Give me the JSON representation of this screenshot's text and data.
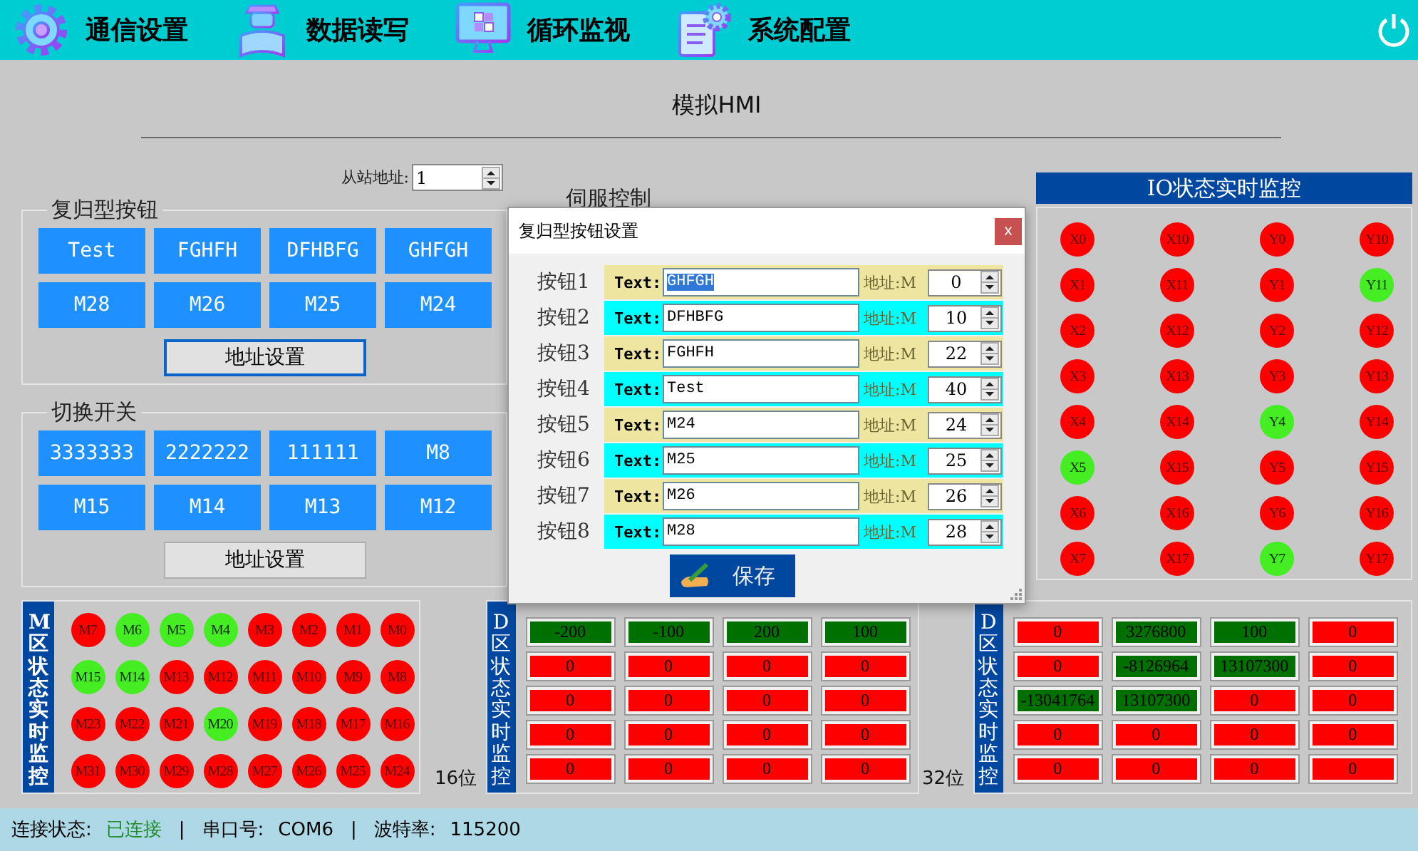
{
  "nav": {
    "items": [
      {
        "label": "通信设置"
      },
      {
        "label": "数据读写"
      },
      {
        "label": "循环监视"
      },
      {
        "label": "系统配置"
      }
    ]
  },
  "title": "模拟HMI",
  "slave_address": {
    "label": "从站地址:",
    "value": "1"
  },
  "reset_buttons": {
    "title": "复归型按钮",
    "buttons": [
      "Test",
      "FGHFH",
      "DFHBFG",
      "GHFGH",
      "M28",
      "M26",
      "M25",
      "M24"
    ],
    "address_button": {
      "label": "地址设置",
      "focused": true
    }
  },
  "toggle_switches": {
    "title": "切换开关",
    "buttons": [
      "3333333",
      "2222222",
      "111111",
      "M8",
      "M15",
      "M14",
      "M13",
      "M12"
    ],
    "address_button": {
      "label": "地址设置",
      "focused": false
    }
  },
  "servo_control": {
    "title": "伺服控制"
  },
  "io_monitor": {
    "title": "IO状态实时监控",
    "lamps": [
      {
        "label": "X0",
        "on": false
      },
      {
        "label": "X10",
        "on": false
      },
      {
        "label": "Y0",
        "on": false
      },
      {
        "label": "Y10",
        "on": false
      },
      {
        "label": "X1",
        "on": false
      },
      {
        "label": "X11",
        "on": false
      },
      {
        "label": "Y1",
        "on": false
      },
      {
        "label": "Y11",
        "on": true
      },
      {
        "label": "X2",
        "on": false
      },
      {
        "label": "X12",
        "on": false
      },
      {
        "label": "Y2",
        "on": false
      },
      {
        "label": "Y12",
        "on": false
      },
      {
        "label": "X3",
        "on": false
      },
      {
        "label": "X13",
        "on": false
      },
      {
        "label": "Y3",
        "on": false
      },
      {
        "label": "Y13",
        "on": false
      },
      {
        "label": "X4",
        "on": false
      },
      {
        "label": "X14",
        "on": false
      },
      {
        "label": "Y4",
        "on": true
      },
      {
        "label": "Y14",
        "on": false
      },
      {
        "label": "X5",
        "on": true
      },
      {
        "label": "X15",
        "on": false
      },
      {
        "label": "Y5",
        "on": false
      },
      {
        "label": "Y15",
        "on": false
      },
      {
        "label": "X6",
        "on": false
      },
      {
        "label": "X16",
        "on": false
      },
      {
        "label": "Y6",
        "on": false
      },
      {
        "label": "Y16",
        "on": false
      },
      {
        "label": "X7",
        "on": false
      },
      {
        "label": "X17",
        "on": false
      },
      {
        "label": "Y7",
        "on": true
      },
      {
        "label": "Y17",
        "on": false
      }
    ]
  },
  "m_monitor": {
    "title": "M区状态实时监控",
    "lamps": [
      {
        "label": "M7",
        "on": false
      },
      {
        "label": "M6",
        "on": true
      },
      {
        "label": "M5",
        "on": true
      },
      {
        "label": "M4",
        "on": true
      },
      {
        "label": "M3",
        "on": false
      },
      {
        "label": "M2",
        "on": false
      },
      {
        "label": "M1",
        "on": false
      },
      {
        "label": "M0",
        "on": false
      },
      {
        "label": "M15",
        "on": true
      },
      {
        "label": "M14",
        "on": true
      },
      {
        "label": "M13",
        "on": false
      },
      {
        "label": "M12",
        "on": false
      },
      {
        "label": "M11",
        "on": false
      },
      {
        "label": "M10",
        "on": false
      },
      {
        "label": "M9",
        "on": false
      },
      {
        "label": "M8",
        "on": false
      },
      {
        "label": "M23",
        "on": false
      },
      {
        "label": "M22",
        "on": false
      },
      {
        "label": "M21",
        "on": false
      },
      {
        "label": "M20",
        "on": true
      },
      {
        "label": "M19",
        "on": false
      },
      {
        "label": "M18",
        "on": false
      },
      {
        "label": "M17",
        "on": false
      },
      {
        "label": "M16",
        "on": false
      },
      {
        "label": "M31",
        "on": false
      },
      {
        "label": "M30",
        "on": false
      },
      {
        "label": "M29",
        "on": false
      },
      {
        "label": "M28",
        "on": false
      },
      {
        "label": "M27",
        "on": false
      },
      {
        "label": "M26",
        "on": false
      },
      {
        "label": "M25",
        "on": false
      },
      {
        "label": "M24",
        "on": false
      }
    ]
  },
  "d16": {
    "caption": "16位",
    "title": "D区状态实时监控",
    "cells": [
      {
        "value": "-200",
        "on": true
      },
      {
        "value": "-100",
        "on": true
      },
      {
        "value": "200",
        "on": true
      },
      {
        "value": "100",
        "on": true
      },
      {
        "value": "0",
        "on": false
      },
      {
        "value": "0",
        "on": false
      },
      {
        "value": "0",
        "on": false
      },
      {
        "value": "0",
        "on": false
      },
      {
        "value": "0",
        "on": false
      },
      {
        "value": "0",
        "on": false
      },
      {
        "value": "0",
        "on": false
      },
      {
        "value": "0",
        "on": false
      },
      {
        "value": "0",
        "on": false
      },
      {
        "value": "0",
        "on": false
      },
      {
        "value": "0",
        "on": false
      },
      {
        "value": "0",
        "on": false
      },
      {
        "value": "0",
        "on": false
      },
      {
        "value": "0",
        "on": false
      },
      {
        "value": "0",
        "on": false
      },
      {
        "value": "0",
        "on": false
      }
    ]
  },
  "d32": {
    "caption": "32位",
    "title": "D区状态实时监控",
    "cells": [
      {
        "value": "0",
        "on": false
      },
      {
        "value": "3276800",
        "on": true
      },
      {
        "value": "100",
        "on": true
      },
      {
        "value": "0",
        "on": false
      },
      {
        "value": "0",
        "on": false
      },
      {
        "value": "-8126964",
        "on": true
      },
      {
        "value": "13107300",
        "on": true
      },
      {
        "value": "0",
        "on": false
      },
      {
        "value": "-13041764",
        "on": true
      },
      {
        "value": "13107300",
        "on": true
      },
      {
        "value": "0",
        "on": false
      },
      {
        "value": "0",
        "on": false
      },
      {
        "value": "0",
        "on": false
      },
      {
        "value": "0",
        "on": false
      },
      {
        "value": "0",
        "on": false
      },
      {
        "value": "0",
        "on": false
      },
      {
        "value": "0",
        "on": false
      },
      {
        "value": "0",
        "on": false
      },
      {
        "value": "0",
        "on": false
      },
      {
        "value": "0",
        "on": false
      }
    ]
  },
  "status_bar": {
    "items": [
      {
        "label": "连接状态:",
        "value": "已连接",
        "kind": "status",
        "separator": "|"
      },
      {
        "label": "串口号:",
        "value": "COM6",
        "kind": "plain",
        "separator": "|"
      },
      {
        "label": "波特率:",
        "value": "115200",
        "kind": "plain"
      }
    ]
  },
  "dialog": {
    "title": "复归型按钮设置",
    "close": "x",
    "save": "保存",
    "rows": [
      {
        "label": "按钮1",
        "text_label": "Text:",
        "text": "GHFGH",
        "text_selected": true,
        "address_label": "地址:M",
        "address": "0"
      },
      {
        "label": "按钮2",
        "text_label": "Text:",
        "text": "DFHBFG",
        "text_selected": false,
        "address_label": "地址:M",
        "address": "10"
      },
      {
        "label": "按钮3",
        "text_label": "Text:",
        "text": "FGHFH",
        "text_selected": false,
        "address_label": "地址:M",
        "address": "22"
      },
      {
        "label": "按钮4",
        "text_label": "Text:",
        "text": "Test",
        "text_selected": false,
        "address_label": "地址:M",
        "address": "40"
      },
      {
        "label": "按钮5",
        "text_label": "Text:",
        "text": "M24",
        "text_selected": false,
        "address_label": "地址:M",
        "address": "24"
      },
      {
        "label": "按钮6",
        "text_label": "Text:",
        "text": "M25",
        "text_selected": false,
        "address_label": "地址:M",
        "address": "25"
      },
      {
        "label": "按钮7",
        "text_label": "Text:",
        "text": "M26",
        "text_selected": false,
        "address_label": "地址:M",
        "address": "26"
      },
      {
        "label": "按钮8",
        "text_label": "Text:",
        "text": "M28",
        "text_selected": false,
        "address_label": "地址:M",
        "address": "28"
      }
    ]
  }
}
